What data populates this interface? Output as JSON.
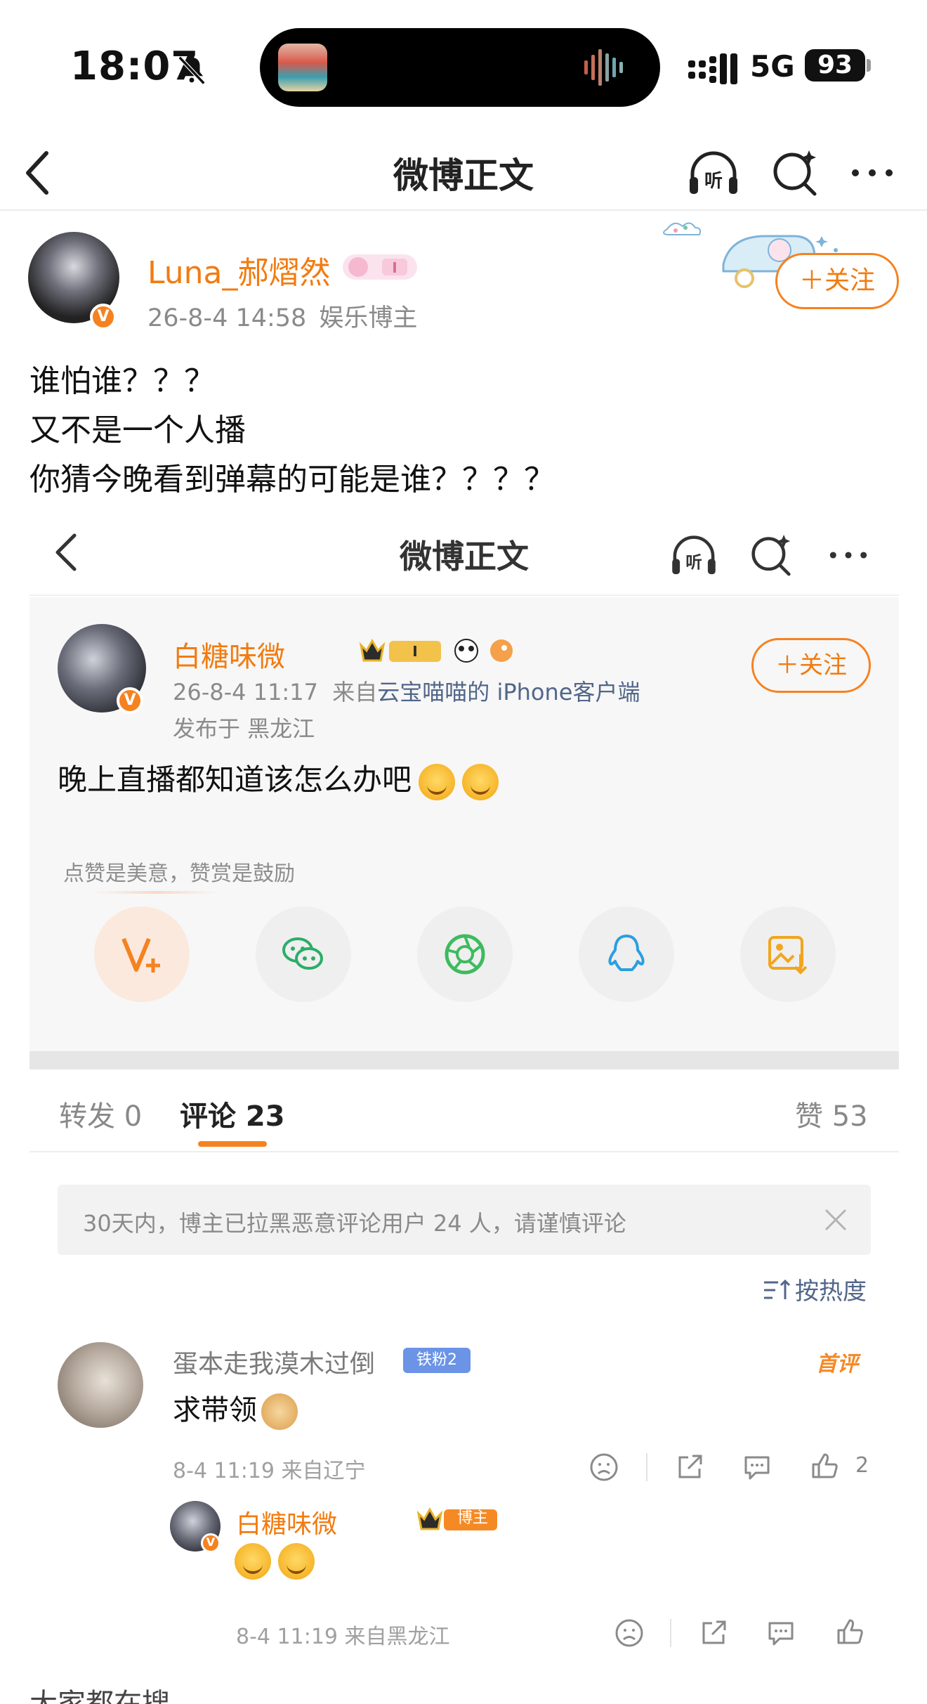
{
  "status_bar": {
    "time": "18:07",
    "network": "5G",
    "battery": "93"
  },
  "nav": {
    "title": "微博正文"
  },
  "post": {
    "username": "Luna_郝熠然",
    "date": "26-8-4 14:58",
    "tag": "娱乐博主",
    "follow_label": "＋关注",
    "lines": [
      "谁怕谁？？？",
      "又不是一个人播",
      "你猜今晚看到弹幕的可能是谁？？？？"
    ]
  },
  "embed": {
    "nav_title": "微博正文",
    "username": "白糖味微",
    "meta_date": "26-8-4 11:17",
    "meta_from_prefix": "来自",
    "meta_source": "云宝喵喵的 iPhone客户端",
    "meta_location": "发布于 黑龙江",
    "follow_label": "＋关注",
    "text": "晚上直播都知道该怎么办吧",
    "tip": "点赞是美意，赞赏是鼓励",
    "tabs": {
      "repost": "转发 0",
      "comments": "评论 23",
      "likes": "赞 53"
    },
    "notice": "30天内，博主已拉黑恶意评论用户 24 人，请谨慎评论",
    "sort_label": "按热度",
    "comment": {
      "username": "蛋本走我漠木过倒",
      "fan_badge": "铁粉2",
      "first_label": "首评",
      "text": "求带领",
      "meta": "8-4 11:19  来自辽宁",
      "like_count": "2"
    },
    "reply": {
      "username": "白糖味微",
      "badge": "博主",
      "meta": "8-4 11:19  来自黑龙江"
    }
  },
  "bottom_peek": "大家都在搜",
  "colors": {
    "accent": "#f58220",
    "link": "#52668a",
    "fan_badge": "#6b93e6"
  }
}
